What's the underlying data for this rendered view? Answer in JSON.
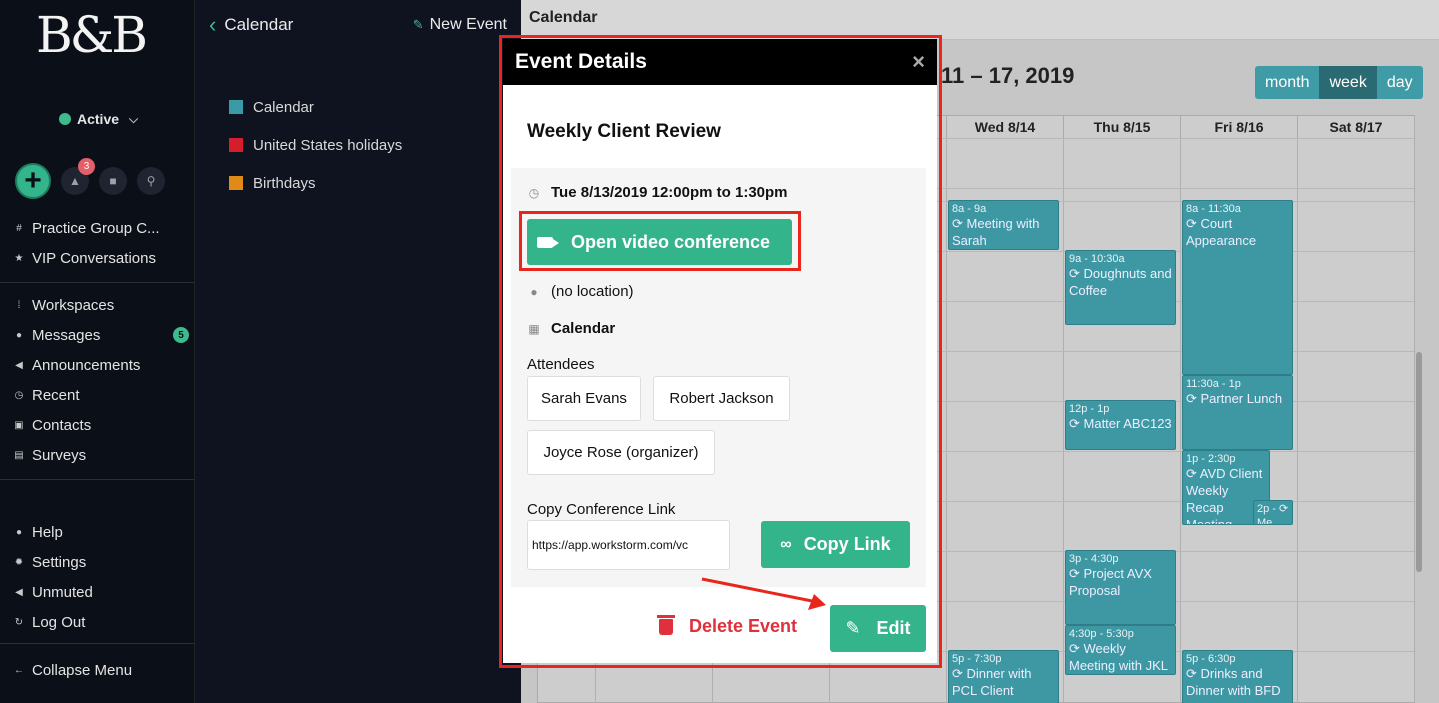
{
  "brand": {
    "logo_text": "B&B"
  },
  "status": {
    "label": "Active"
  },
  "quick_actions": {
    "alerts_badge": "3"
  },
  "nav": {
    "top_items": [
      {
        "label": "Practice Group C...",
        "icon": "hash-icon"
      },
      {
        "label": "VIP Conversations",
        "icon": "star-icon"
      }
    ],
    "items": [
      {
        "label": "Workspaces",
        "icon": "grid-icon"
      },
      {
        "label": "Messages",
        "icon": "chat-icon",
        "badge": "5"
      },
      {
        "label": "Announcements",
        "icon": "megaphone-icon"
      },
      {
        "label": "Recent",
        "icon": "clock-icon"
      },
      {
        "label": "Contacts",
        "icon": "contacts-icon"
      },
      {
        "label": "Surveys",
        "icon": "clipboard-icon"
      }
    ],
    "bottom_items": [
      {
        "label": "Help",
        "icon": "help-icon"
      },
      {
        "label": "Settings",
        "icon": "gear-icon"
      },
      {
        "label": "Unmuted",
        "icon": "speaker-icon"
      },
      {
        "label": "Log Out",
        "icon": "logout-icon"
      }
    ],
    "collapse_label": "Collapse Menu"
  },
  "calendar_sidebar": {
    "title": "Calendar",
    "new_event_label": "New Event",
    "calendars": [
      {
        "label": "Calendar",
        "color": "#3a9aa6"
      },
      {
        "label": "United States holidays",
        "color": "#d61d2c"
      },
      {
        "label": "Birthdays",
        "color": "#e08a17"
      }
    ]
  },
  "main": {
    "title": "Calendar",
    "range_label": "11 – 17, 2019",
    "views": [
      "month",
      "week",
      "day"
    ],
    "active_view": "week",
    "day_headers": [
      "Wed 8/14",
      "Thu 8/15",
      "Fri 8/16",
      "Sat 8/17"
    ],
    "events": [
      {
        "time": "8a - 9a",
        "title": "⟳ Meeting with Sarah"
      },
      {
        "time": "9a - 10:30a",
        "title": "⟳ Doughnuts and Coffee"
      },
      {
        "time": "8a - 11:30a",
        "title": "⟳ Court Appearance"
      },
      {
        "time": "12p - 1p",
        "title": "⟳ Matter ABC123"
      },
      {
        "time": "11:30a - 1p",
        "title": "⟳ Partner Lunch"
      },
      {
        "time": "1p - 2:30p",
        "title": "⟳ AVD Client Weekly Recap Meeting"
      },
      {
        "time": "2p - ⟳ Me",
        "title": ""
      },
      {
        "time": "3p - 4:30p",
        "title": "⟳ Project AVX Proposal"
      },
      {
        "time": "4:30p - 5:30p",
        "title": "⟳ Weekly Meeting with JKL"
      },
      {
        "time": "5p - 7:30p",
        "title": "⟳ Dinner with PCL Client"
      },
      {
        "time": "5p - 6:30p",
        "title": "⟳ Drinks and Dinner with BFD"
      }
    ]
  },
  "modal": {
    "header": "Event Details",
    "close_glyph": "×",
    "event_title": "Weekly Client Review",
    "datetime": "Tue 8/13/2019 12:00pm to 1:30pm",
    "video_button": "Open video conference",
    "location": "(no location)",
    "calendar": "Calendar",
    "attendees_label": "Attendees",
    "attendees": [
      "Sarah Evans",
      "Robert Jackson",
      "Joyce Rose (organizer)"
    ],
    "copy_label": "Copy Conference Link",
    "link_value": "https://app.workstorm.com/vc",
    "copy_button": "Copy Link",
    "delete_button": "Delete Event",
    "edit_button": "Edit"
  },
  "colors": {
    "accent": "#34b48a",
    "danger": "#e0303b",
    "event": "#3d98a4",
    "highlight": "#e8261c"
  }
}
